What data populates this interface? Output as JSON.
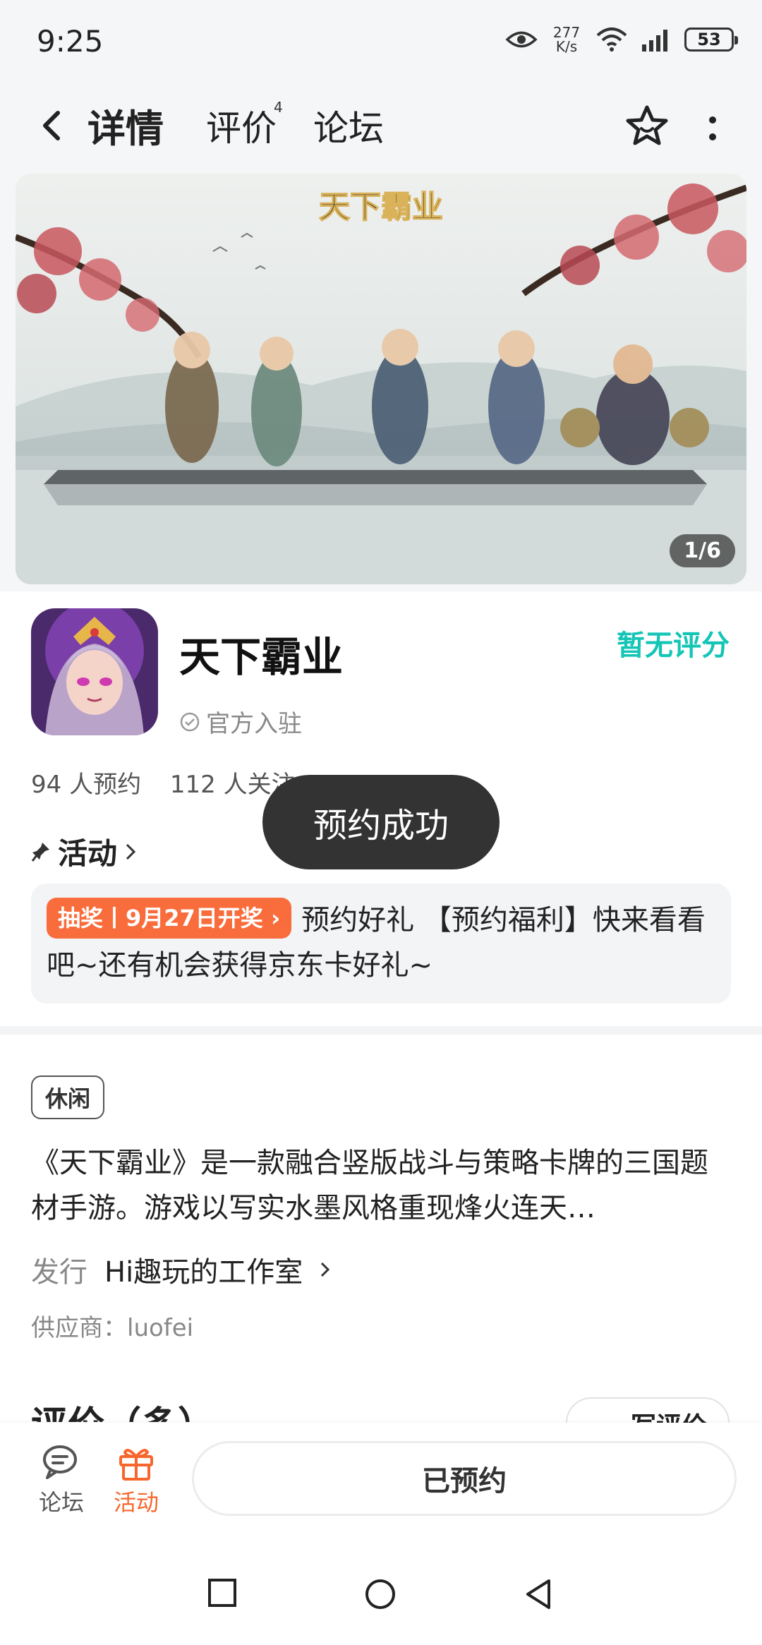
{
  "status_bar": {
    "time": "9:25",
    "net_speed_value": "277",
    "net_speed_unit": "K/s",
    "battery": "53"
  },
  "header": {
    "tabs": [
      {
        "label": "详情",
        "active": true
      },
      {
        "label": "评价",
        "badge": "4"
      },
      {
        "label": "论坛"
      }
    ]
  },
  "banner": {
    "logo_text": "天下霸业",
    "counter": "1/6"
  },
  "game": {
    "name": "天下霸业",
    "official_label": "官方入驻",
    "rating": "暂无评分",
    "reservations": "94 人预约",
    "followers": "112 人关注"
  },
  "activity": {
    "title": "活动",
    "tag": "抽奖丨9月27日开奖",
    "text": "预约好礼 【预约福利】快来看看吧~还有机会获得京东卡好礼~"
  },
  "detail": {
    "genre": "休闲",
    "description": "《天下霸业》是一款融合竖版战斗与策略卡牌的三国题材手游。游戏以写实水墨风格重现烽火连天…",
    "publisher_label": "发行",
    "publisher": "Hi趣玩的工作室",
    "supplier": "供应商：luofei"
  },
  "reviews_peek": {
    "title": "评价（多）",
    "write_label": "写评价"
  },
  "toast": "预约成功",
  "bottom_bar": {
    "forum_label": "论坛",
    "activity_label": "活动",
    "reserve_button": "已预约"
  },
  "colors": {
    "accent_teal": "#14d2c4",
    "rating_teal": "#14c5b6",
    "orange": "#f96d3c",
    "toast_bg": "#333333"
  }
}
